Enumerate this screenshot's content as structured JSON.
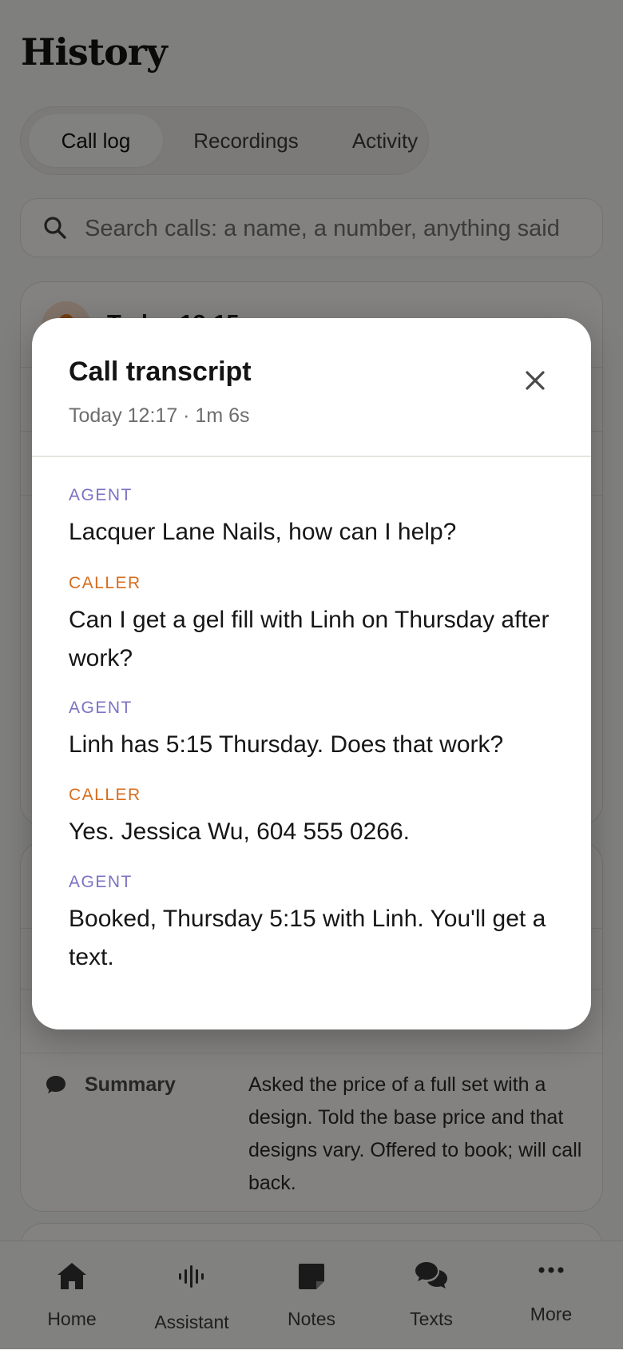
{
  "page": {
    "title": "History"
  },
  "segmented": {
    "tabs": [
      {
        "label": "Call log",
        "active": true
      },
      {
        "label": "Recordings",
        "active": false
      },
      {
        "label": "Activity",
        "active": false
      }
    ]
  },
  "search": {
    "placeholder": "Search calls: a name, a number, anything said"
  },
  "call_card": {
    "time": "Today 12:15"
  },
  "summary_card": {
    "label": "Summary",
    "text": "Asked the price of a full set with a design. Told the base price and that designs vary. Offered to book; will call back."
  },
  "tabbar": {
    "items": [
      {
        "label": "Home",
        "icon": "home-icon"
      },
      {
        "label": "Assistant",
        "icon": "waveform-icon"
      },
      {
        "label": "Notes",
        "icon": "note-icon"
      },
      {
        "label": "Texts",
        "icon": "chat-bubbles-icon"
      },
      {
        "label": "More",
        "icon": "more-dots-icon"
      }
    ]
  },
  "modal": {
    "title": "Call transcript",
    "subtitle": "Today 12:17 · 1m 6s",
    "close_icon": "close-icon",
    "speaker_colors": {
      "agent": "#7b72c4",
      "caller": "#d56d1f"
    },
    "transcript": [
      {
        "speaker": "AGENT",
        "text": "Lacquer Lane Nails, how can I help?"
      },
      {
        "speaker": "CALLER",
        "text": "Can I get a gel fill with Linh on Thursday after work?"
      },
      {
        "speaker": "AGENT",
        "text": "Linh has 5:15 Thursday. Does that work?"
      },
      {
        "speaker": "CALLER",
        "text": "Yes. Jessica Wu, 604 555 0266."
      },
      {
        "speaker": "AGENT",
        "text": "Booked, Thursday 5:15 with Linh. You'll get a text."
      }
    ]
  }
}
